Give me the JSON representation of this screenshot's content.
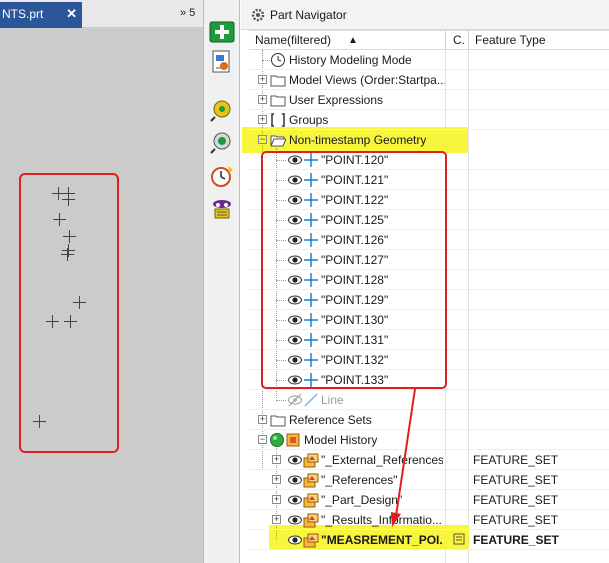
{
  "graphics": {
    "doc_tab_label": "NTS.prt",
    "doc_tab_close": "✕",
    "tab_overflow_label": "» 5"
  },
  "navigator": {
    "title": "Part Navigator",
    "columns": {
      "name": "Name(filtered)",
      "sort_indicator": "▲",
      "c": "C.",
      "feature_type": "Feature Type"
    },
    "nodes": {
      "history_mode": "History Modeling Mode",
      "model_views": "Model Views (Order:Startpa...",
      "user_expressions": "User Expressions",
      "groups": "Groups",
      "non_timestamp": "Non-timestamp Geometry",
      "line": "Line",
      "reference_sets": "Reference Sets",
      "model_history": "Model History"
    },
    "points": [
      "\"POINT.120\"",
      "\"POINT.121\"",
      "\"POINT.122\"",
      "\"POINT.125\"",
      "\"POINT.126\"",
      "\"POINT.127\"",
      "\"POINT.128\"",
      "\"POINT.129\"",
      "\"POINT.130\"",
      "\"POINT.131\"",
      "\"POINT.132\"",
      "\"POINT.133\""
    ],
    "features": [
      {
        "name": "\"_External_References\"",
        "type": "FEATURE_SET"
      },
      {
        "name": "\"_References\"",
        "type": "FEATURE_SET"
      },
      {
        "name": "\"_Part_Design\"",
        "type": "FEATURE_SET"
      },
      {
        "name": "\"_Results_Informatio...",
        "type": "FEATURE_SET"
      },
      {
        "name": "\"MEASREMENT_POI...",
        "type": "FEATURE_SET"
      }
    ]
  },
  "colors": {
    "highlight": "#f7f53c",
    "annotation_red": "#e02020",
    "tab_blue": "#2b579a",
    "point_cross": "#1a7fd0"
  }
}
